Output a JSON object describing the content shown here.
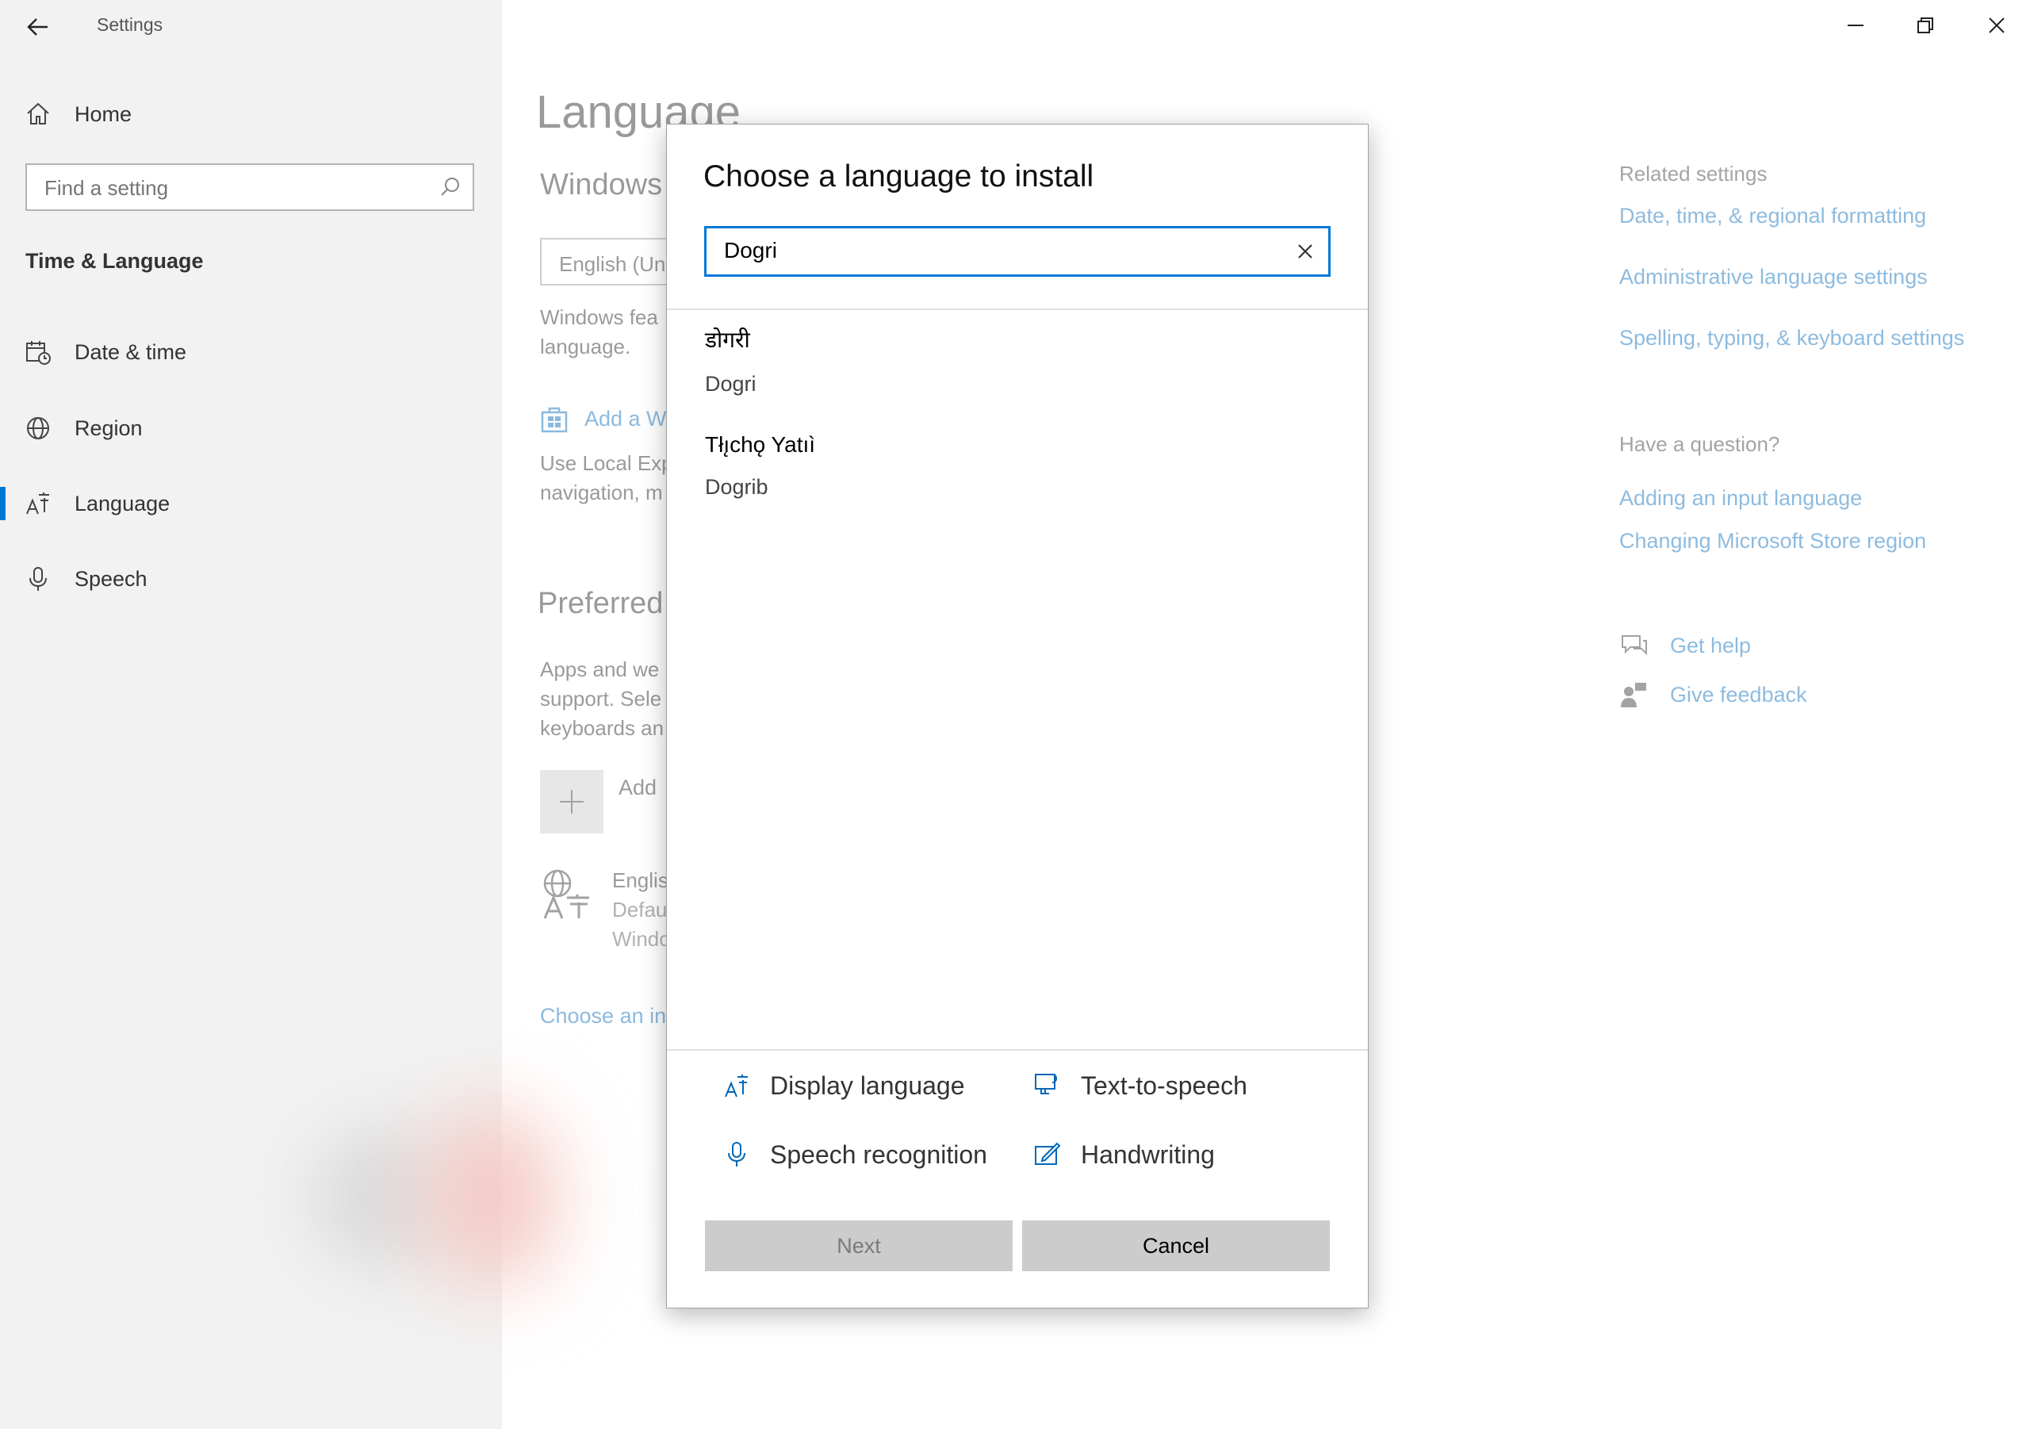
{
  "window": {
    "title": "Settings"
  },
  "sidebar": {
    "home_label": "Home",
    "search_placeholder": "Find a setting",
    "section_title": "Time & Language",
    "items": [
      {
        "label": "Date & time",
        "icon": "calendar-clock-icon"
      },
      {
        "label": "Region",
        "icon": "globe-icon"
      },
      {
        "label": "Language",
        "icon": "language-icon",
        "selected": true
      },
      {
        "label": "Speech",
        "icon": "microphone-icon"
      }
    ]
  },
  "main": {
    "page_title": "Language",
    "windows_display_heading": "Windows",
    "display_language_value": "English (Un",
    "windows_features_text_1": "Windows fea",
    "windows_features_text_2": "language.",
    "add_windows_link": "Add a W",
    "local_exp_text_1": "Use Local Exp",
    "local_exp_text_2": "navigation, m",
    "preferred_heading": "Preferred",
    "apps_text_1": "Apps and we",
    "apps_text_2": "support. Sele",
    "apps_text_3": "keyboards an",
    "add_language_label": "Add",
    "english_lang_1": "Englis",
    "english_lang_2": "Defau",
    "english_lang_3": "Windo",
    "choose_input_link": "Choose an in"
  },
  "related": {
    "heading": "Related settings",
    "links": [
      "Date, time, & regional formatting",
      "Administrative language settings",
      "Spelling, typing, & keyboard settings"
    ],
    "question_heading": "Have a question?",
    "question_links": [
      "Adding an input language",
      "Changing Microsoft Store region"
    ],
    "get_help": "Get help",
    "give_feedback": "Give feedback"
  },
  "dialog": {
    "title": "Choose a language to install",
    "search_value": "Dogri",
    "results": [
      {
        "native": "डोगरी",
        "english": "Dogri"
      },
      {
        "native": "Tłı̨chǫ Yatıì",
        "english": "Dogrib"
      }
    ],
    "features": {
      "display_language": "Display language",
      "text_to_speech": "Text-to-speech",
      "speech_recognition": "Speech recognition",
      "handwriting": "Handwriting"
    },
    "next_label": "Next",
    "cancel_label": "Cancel"
  },
  "colors": {
    "accent": "#0078d7",
    "link": "#0067b8",
    "sidebar_bg": "#f2f2f2",
    "button_bg": "#cccccc"
  }
}
